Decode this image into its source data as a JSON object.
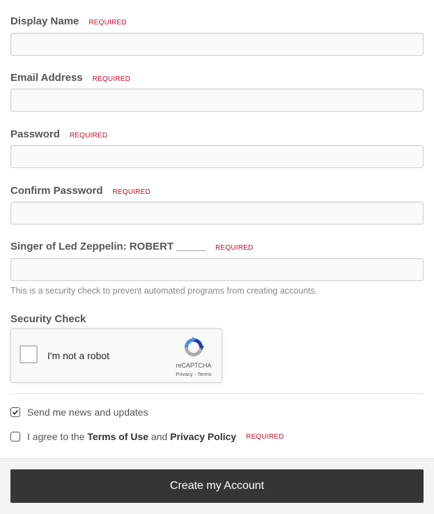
{
  "fields": [
    {
      "label": "Display Name",
      "required": "REQUIRED",
      "value": ""
    },
    {
      "label": "Email Address",
      "required": "REQUIRED",
      "value": ""
    },
    {
      "label": "Password",
      "required": "REQUIRED",
      "value": ""
    },
    {
      "label": "Confirm Password",
      "required": "REQUIRED",
      "value": ""
    },
    {
      "label": "Singer of Led Zeppelin: ROBERT _____",
      "required": "REQUIRED",
      "value": ""
    }
  ],
  "security_help": "This is a security check to prevent automated programs from creating accounts.",
  "security_check": {
    "label": "Security Check",
    "recaptcha_text": "I'm not a robot",
    "recaptcha_brand": "reCAPTCHA",
    "recaptcha_links": "Privacy - Terms"
  },
  "newsletter": {
    "label": "Send me news and updates",
    "checked": true
  },
  "agree": {
    "prefix": "I agree to the",
    "terms": "Terms of Use",
    "and": "and",
    "privacy": "Privacy Policy",
    "required": "REQUIRED",
    "checked": false
  },
  "submit_label": "Create my Account",
  "colors": {
    "required": "#c8102e",
    "button": "#353535",
    "recaptcha_blue": "#1c3aa9",
    "recaptcha_light": "#4a90e2",
    "recaptcha_gray": "#ababab"
  }
}
